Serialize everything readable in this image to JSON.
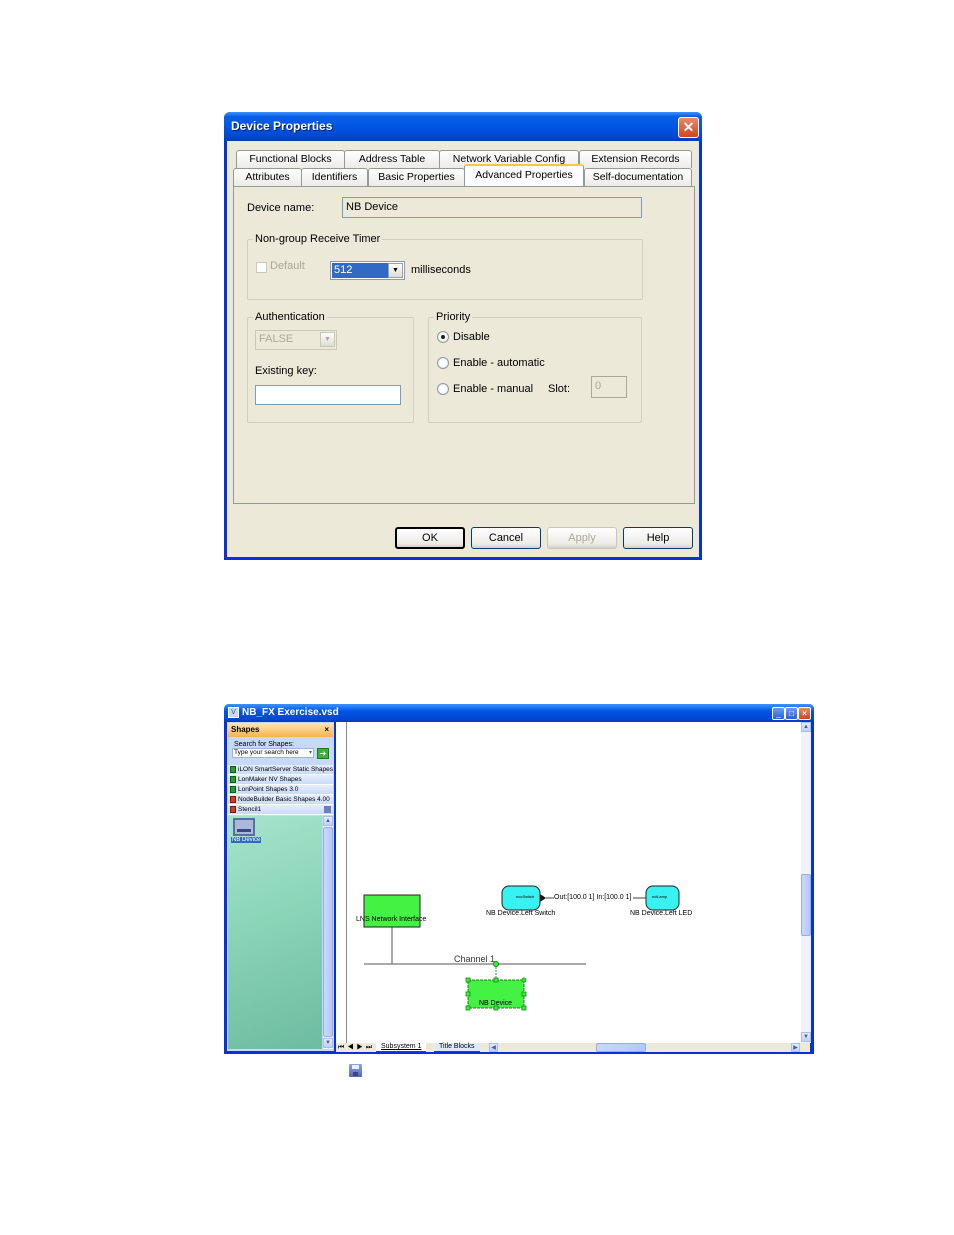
{
  "dialog": {
    "title": "Device Properties",
    "close_icon": "close-icon",
    "tabs_row1": [
      "Functional Blocks",
      "Address Table",
      "Network Variable Config",
      "Extension Records"
    ],
    "tabs_row2": [
      "Attributes",
      "Identifiers",
      "Basic Properties",
      "Advanced Properties",
      "Self-documentation"
    ],
    "active_tab": "Advanced Properties",
    "device_name_label": "Device name:",
    "device_name_value": "NB Device",
    "timer_group": {
      "legend": "Non-group Receive Timer",
      "default_label": "Default",
      "default_checked": false,
      "value": "512",
      "unit": "milliseconds"
    },
    "authentication": {
      "legend": "Authentication",
      "value": "FALSE",
      "existing_key_label": "Existing key:",
      "existing_key_value": ""
    },
    "priority": {
      "legend": "Priority",
      "options": [
        "Disable",
        "Enable - automatic",
        "Enable - manual"
      ],
      "selected": "Disable",
      "slot_label": "Slot:",
      "slot_value": "0"
    },
    "buttons": {
      "ok": "OK",
      "cancel": "Cancel",
      "apply": "Apply",
      "help": "Help"
    }
  },
  "visio": {
    "title": "NB_FX Exercise.vsd",
    "window_buttons": {
      "minimize": "_",
      "maximize": "□",
      "close": "×"
    },
    "shapes_pane": {
      "title": "Shapes",
      "close": "×",
      "search_label": "Search for Shapes:",
      "search_placeholder": "Type your search here",
      "stencils": [
        "iLON SmartServer Static Shapes",
        "LonMaker NV Shapes",
        "LonPoint Shapes 3.0",
        "NodeBuilder Basic Shapes 4.00",
        "Stencil1"
      ],
      "master_shape": "NB Device"
    },
    "diagram": {
      "lns_interface_label": "LNS Network Interface",
      "left_switch_label": "NB Device.Left Switch",
      "left_switch_inner": "nvoSwitch",
      "left_led_label": "NB Device.Left LED",
      "left_led_inner": "nviLamp",
      "connection_label": "Out:[100.0 1] In:[100.0 1]",
      "channel_label": "Channel 1",
      "device_label": "NB Device"
    },
    "page_tabs": [
      "Subsystem 1",
      "Title Blocks"
    ],
    "active_page": "Subsystem 1",
    "nav_buttons": [
      "⏮",
      "◀",
      "▶",
      "⏭"
    ]
  },
  "colors": {
    "xp_blue": "#0055e5",
    "dialog_bg": "#ece9d8",
    "device_green": "#44f244",
    "fb_cyan": "#38f2f2"
  }
}
